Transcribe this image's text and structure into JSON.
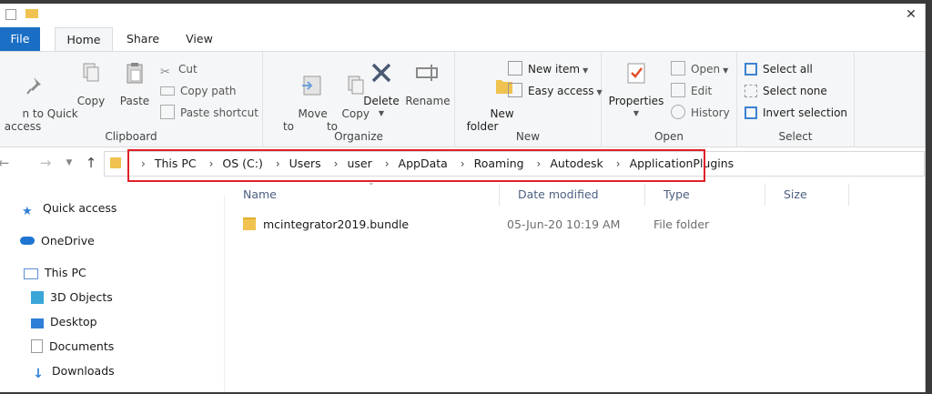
{
  "ribbon_tabs": [
    "File",
    "Home",
    "Share",
    "View"
  ],
  "clipboard": {
    "label": "Clipboard",
    "pin_label": "n to Quick\naccess",
    "copy": "Copy",
    "paste": "Paste",
    "cut": "Cut",
    "copy_path": "Copy path",
    "paste_shortcut": "Paste shortcut"
  },
  "organize": {
    "label": "Organize",
    "move_to": "Move\nto",
    "copy_to": "Copy\nto",
    "delete": "Delete",
    "rename": "Rename"
  },
  "new_group": {
    "label": "New",
    "new_folder": "New\nfolder",
    "new_item": "New item",
    "easy_access": "Easy access"
  },
  "open_group": {
    "label": "Open",
    "properties": "Properties",
    "open": "Open",
    "edit": "Edit",
    "history": "History"
  },
  "select_group": {
    "label": "Select",
    "select_all": "Select all",
    "select_none": "Select none",
    "invert": "Invert selection"
  },
  "breadcrumb": [
    "This PC",
    "OS (C:)",
    "Users",
    "user",
    "AppData",
    "Roaming",
    "Autodesk",
    "ApplicationPlugins"
  ],
  "columns": {
    "name": "Name",
    "date": "Date modified",
    "type": "Type",
    "size": "Size"
  },
  "nav": {
    "quick_access": "Quick access",
    "onedrive": "OneDrive",
    "this_pc": "This PC",
    "objects3d": "3D Objects",
    "desktop": "Desktop",
    "documents": "Documents",
    "downloads": "Downloads"
  },
  "files": [
    {
      "name": "mcintegrator2019.bundle",
      "date": "05-Jun-20 10:19 AM",
      "type": "File folder"
    }
  ],
  "colors": {
    "file_tab": "#1a6fc4",
    "highlight": "#e0202a",
    "folder": "#f0c24f"
  }
}
